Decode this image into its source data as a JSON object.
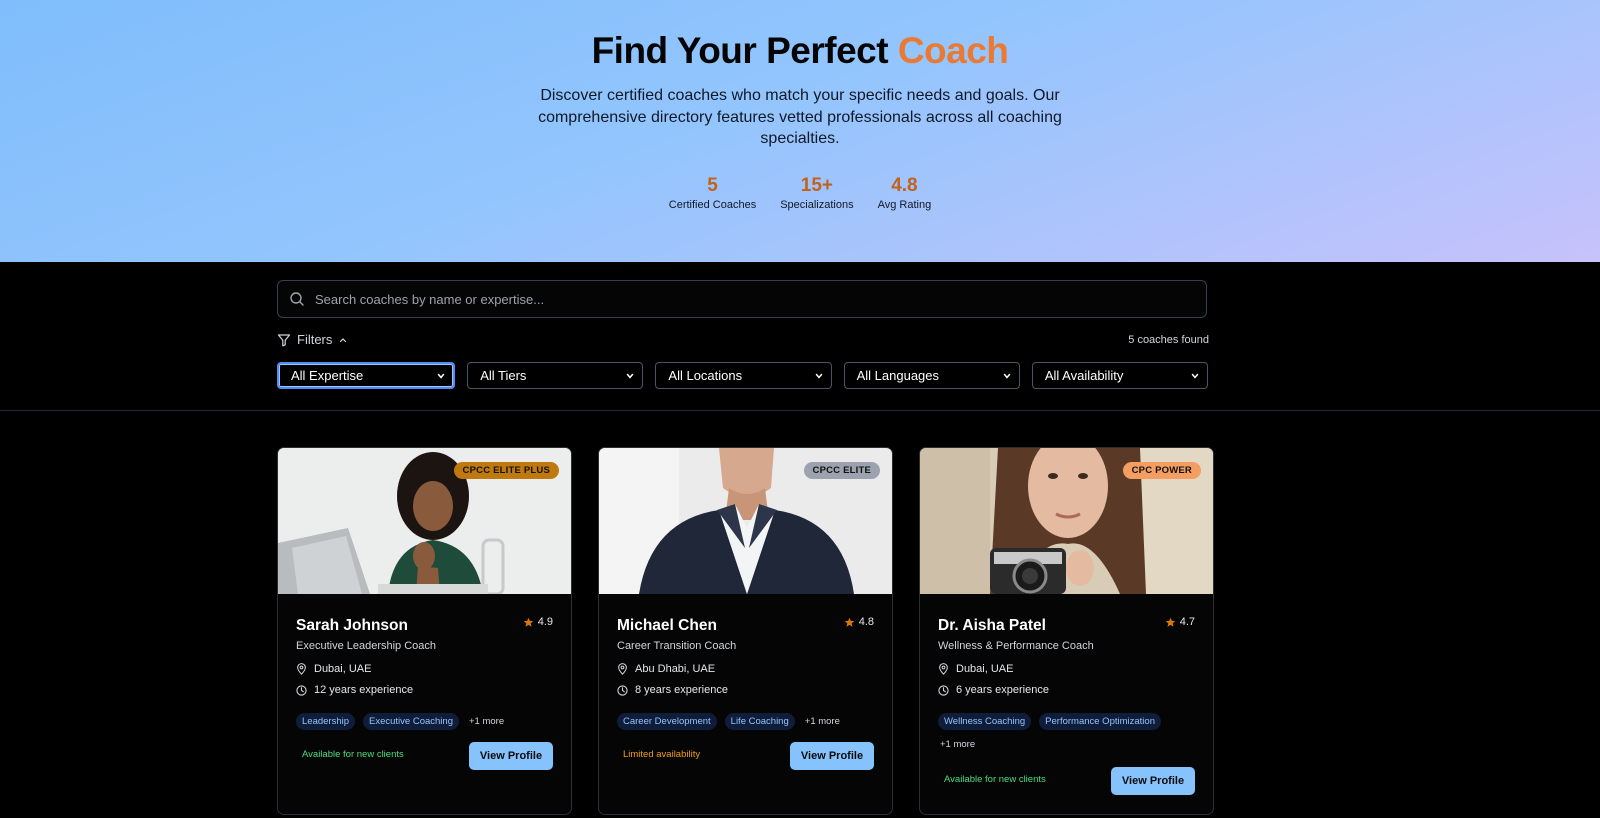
{
  "hero": {
    "title_main": "Find Your Perfect",
    "title_accent": "Coach",
    "subtitle": "Discover certified coaches who match your specific needs and goals. Our comprehensive directory features vetted professionals across all coaching specialties.",
    "stats": [
      {
        "value": "5",
        "label": "Certified Coaches"
      },
      {
        "value": "15+",
        "label": "Specializations"
      },
      {
        "value": "4.8",
        "label": "Avg Rating"
      }
    ]
  },
  "search": {
    "placeholder": "Search coaches by name or expertise...",
    "value": ""
  },
  "filters": {
    "toggle_label": "Filters",
    "results_count": "5 coaches found",
    "selects": [
      "All Expertise",
      "All Tiers",
      "All Locations",
      "All Languages",
      "All Availability"
    ]
  },
  "coaches": [
    {
      "tier": "CPCC ELITE PLUS",
      "name": "Sarah Johnson",
      "rating": "4.9",
      "title": "Executive Leadership Coach",
      "location": "Dubai, UAE",
      "experience": "12 years experience",
      "tags": [
        "Leadership",
        "Executive Coaching"
      ],
      "more": "+1 more",
      "availability": "Available for new clients",
      "button": "View Profile"
    },
    {
      "tier": "CPCC ELITE",
      "name": "Michael Chen",
      "rating": "4.8",
      "title": "Career Transition Coach",
      "location": "Abu Dhabi, UAE",
      "experience": "8 years experience",
      "tags": [
        "Career Development",
        "Life Coaching"
      ],
      "more": "+1 more",
      "availability": "Limited availability",
      "button": "View Profile"
    },
    {
      "tier": "CPC POWER",
      "name": "Dr. Aisha Patel",
      "rating": "4.7",
      "title": "Wellness & Performance Coach",
      "location": "Dubai, UAE",
      "experience": "6 years experience",
      "tags": [
        "Wellness Coaching",
        "Performance Optimization"
      ],
      "more": "+1 more",
      "availability": "Available for new clients",
      "button": "View Profile"
    }
  ],
  "colors": {
    "accent_orange": "#ea7a33",
    "tier_elite_plus": "#c0790f",
    "tier_elite": "#9ca3af",
    "tier_power": "#f59e61",
    "available_green": "#4ade80",
    "limited_orange": "#f59e0b",
    "button_blue": "#86c2fb",
    "star": "#d97706"
  }
}
